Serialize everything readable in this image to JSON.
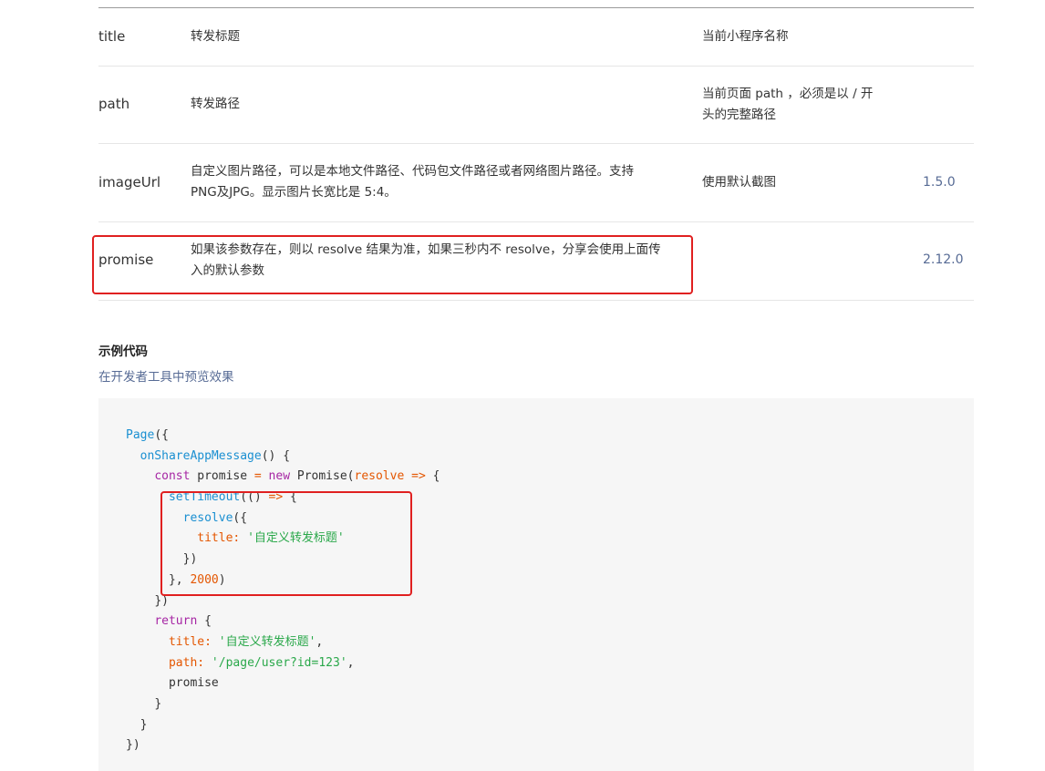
{
  "table": {
    "rows": [
      {
        "name": "title",
        "desc": "转发标题",
        "default": "当前小程序名称",
        "version": ""
      },
      {
        "name": "path",
        "desc": "转发路径",
        "default": "当前页面 path ，必须是以 / 开头的完整路径",
        "version": ""
      },
      {
        "name": "imageUrl",
        "desc": "自定义图片路径，可以是本地文件路径、代码包文件路径或者网络图片路径。支持PNG及JPG。显示图片长宽比是 5:4。",
        "default": "使用默认截图",
        "version": "1.5.0"
      },
      {
        "name": "promise",
        "desc": "如果该参数存在，则以 resolve 结果为准，如果三秒内不 resolve，分享会使用上面传入的默认参数",
        "default": "",
        "version": "2.12.0"
      }
    ]
  },
  "section": {
    "title": "示例代码",
    "preview_link": "在开发者工具中预览效果"
  },
  "code": {
    "t_page": "Page",
    "t_page_open": "({",
    "t_onshare": "onShareAppMessage",
    "t_onshare_rest": "() {",
    "t_const": "const",
    "t_promise_var": " promise ",
    "t_eq": "=",
    "t_new": " new",
    "t_promise_ctor": " Promise(",
    "t_resolve_param": "resolve",
    "t_arrow": " =>",
    "t_brace_open": " {",
    "t_settimeout": "setTimeout",
    "t_st_args": "(()",
    "t_arrow2": " =>",
    "t_brace_open2": " {",
    "t_resolve_call": "resolve",
    "t_resolve_open": "({",
    "t_title_key": "title:",
    "t_title_val": " '自定义转发标题'",
    "t_close_obj": "})",
    "t_close_timeout": "}, ",
    "t_delay": "2000",
    "t_close_paren": ")",
    "t_close_promise": "})",
    "t_return": "return",
    "t_return_brace": " {",
    "t_title_key2": "title:",
    "t_title_val2": " '自定义转发标题'",
    "t_comma": ",",
    "t_path_key": "path:",
    "t_path_val": " '/page/user?id=123'",
    "t_comma2": ",",
    "t_promise_prop": "promise",
    "t_close_return": "}",
    "t_close_method": "}",
    "t_close_page": "})"
  },
  "colors": {
    "link": "#576b95",
    "highlight": "#e02020",
    "code_bg": "#f6f6f6"
  }
}
